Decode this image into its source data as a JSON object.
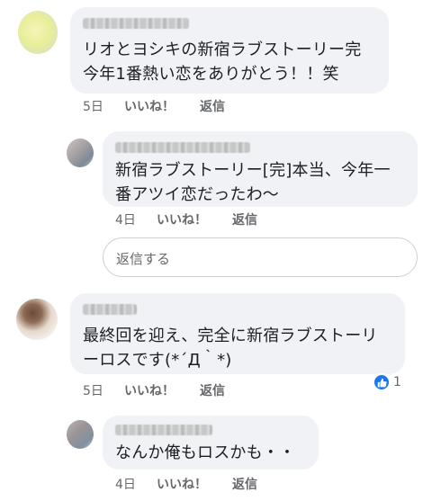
{
  "comments": [
    {
      "id": "c1",
      "text": "リオとヨシキの新宿ラブストーリー完\n今年1番熱い恋をありがとう！！笑",
      "time": "5日",
      "like_label": "いいね！",
      "reply_label": "返信"
    },
    {
      "id": "c2",
      "text": "新宿ラブストーリー[完]本当、今年一\n番アツイ恋だったわ〜",
      "time": "4日",
      "like_label": "いいね！",
      "reply_label": "返信"
    },
    {
      "id": "c3",
      "text": "最終回を迎え、完全に新宿ラブストーリ\nーロスです(*´Д｀*)",
      "time": "5日",
      "like_label": "いいね！",
      "reply_label": "返信",
      "reaction_count": "1"
    },
    {
      "id": "c4",
      "text": "なんか俺もロスかも・・",
      "time": "4日",
      "like_label": "いいね！",
      "reply_label": "返信"
    }
  ],
  "reply_box": {
    "placeholder": "返信する"
  },
  "icons": {
    "reaction": "like-thumb-icon"
  },
  "colors": {
    "bubble": "#f0f2f5",
    "meta_text": "#65676b",
    "like_blue": "#1877f2"
  }
}
